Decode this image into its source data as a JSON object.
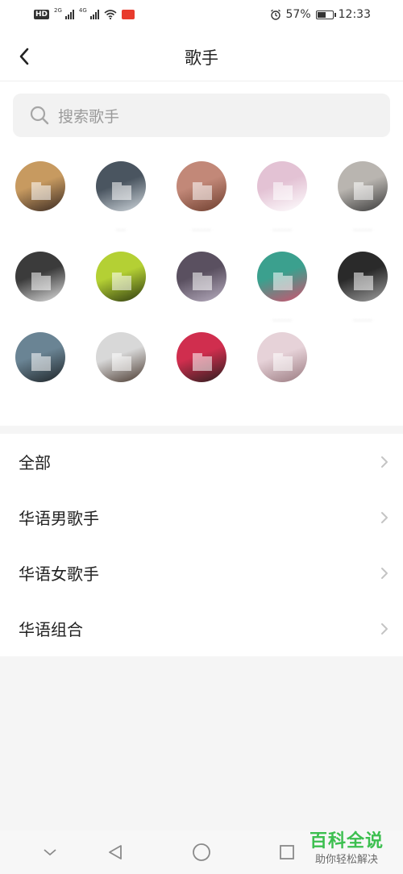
{
  "status_bar": {
    "network_left": "HD",
    "sim1_label": "2G",
    "sim2_label": "4G",
    "battery_text": "57%",
    "battery_level": 0.57,
    "time": "12:33"
  },
  "header": {
    "title": "歌手"
  },
  "search": {
    "placeholder": "搜索歌手"
  },
  "artists": [
    {
      "name": "",
      "colors": [
        "#c79a60",
        "#3a2a22"
      ]
    },
    {
      "name": "…",
      "colors": [
        "#4a5560",
        "#cfd6dc"
      ]
    },
    {
      "name": "……",
      "colors": [
        "#c28878",
        "#6e3e2e"
      ]
    },
    {
      "name": "……",
      "colors": [
        "#e3c2d4",
        "#ffffff"
      ]
    },
    {
      "name": "……",
      "colors": [
        "#b9b5b0",
        "#3a3a3a"
      ]
    },
    {
      "name": "",
      "colors": [
        "#3b3b3b",
        "#dedede"
      ]
    },
    {
      "name": "",
      "colors": [
        "#b4d034",
        "#2e3a10"
      ]
    },
    {
      "name": "",
      "colors": [
        "#5a5060",
        "#b8aec0"
      ]
    },
    {
      "name": "……",
      "colors": [
        "#3ba08e",
        "#d2506e"
      ]
    },
    {
      "name": "……",
      "colors": [
        "#2a2a2a",
        "#a0a0a0"
      ]
    },
    {
      "name": "",
      "colors": [
        "#6a8494",
        "#1e2428"
      ]
    },
    {
      "name": "",
      "colors": [
        "#d8d8d8",
        "#4a3a30"
      ]
    },
    {
      "name": "",
      "colors": [
        "#d02e4e",
        "#2a1e1e"
      ]
    },
    {
      "name": "",
      "colors": [
        "#e6d2d8",
        "#9a7a80"
      ]
    }
  ],
  "categories": [
    {
      "label": "全部"
    },
    {
      "label": "华语男歌手"
    },
    {
      "label": "华语女歌手"
    },
    {
      "label": "华语组合"
    }
  ],
  "watermark": {
    "title": "百科全说",
    "subtitle": "助你轻松解决"
  }
}
